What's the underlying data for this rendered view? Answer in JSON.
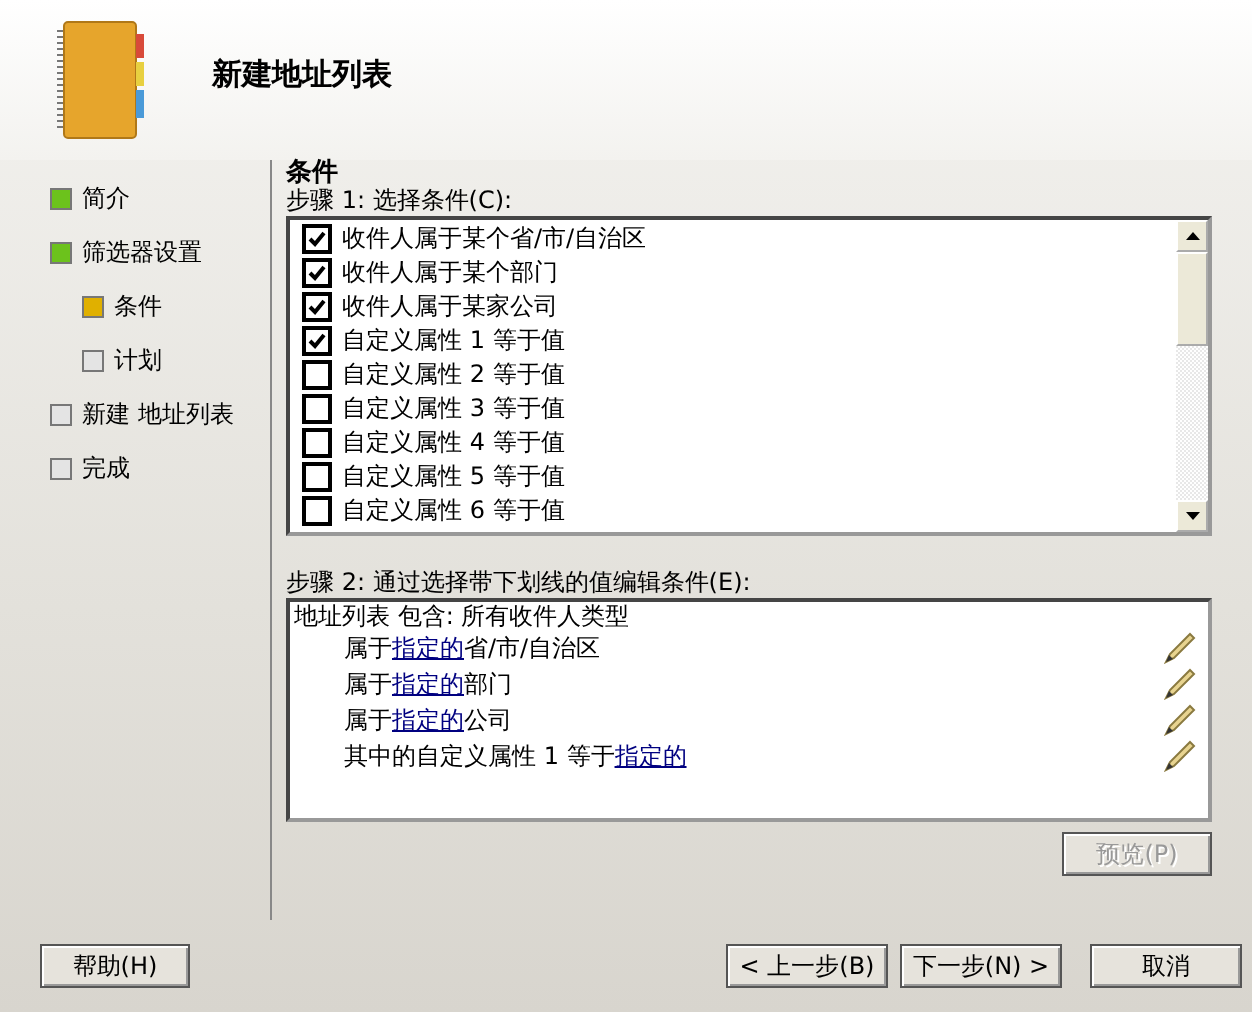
{
  "wizard": {
    "title": "新建地址列表"
  },
  "nav": [
    {
      "label": "简介",
      "completed": true,
      "selected": false
    },
    {
      "label": "筛选器设置",
      "completed": true,
      "selected": false,
      "children": [
        {
          "label": "条件",
          "completed": false,
          "selected": true
        },
        {
          "label": "计划",
          "completed": false,
          "selected": false
        }
      ]
    },
    {
      "label": "新建 地址列表",
      "completed": false,
      "selected": false
    },
    {
      "label": "完成",
      "completed": false,
      "selected": false
    }
  ],
  "page": {
    "heading": "条件",
    "step1_label": "步骤 1: 选择条件(C):",
    "conditions": [
      {
        "label": "收件人属于某个省/市/自治区",
        "checked": true
      },
      {
        "label": "收件人属于某个部门",
        "checked": true
      },
      {
        "label": "收件人属于某家公司",
        "checked": true
      },
      {
        "label": "自定义属性 1 等于值",
        "checked": true
      },
      {
        "label": "自定义属性 2 等于值",
        "checked": false
      },
      {
        "label": "自定义属性 3 等于值",
        "checked": false
      },
      {
        "label": "自定义属性 4 等于值",
        "checked": false
      },
      {
        "label": "自定义属性 5 等于值",
        "checked": false
      },
      {
        "label": "自定义属性 6 等于值",
        "checked": false
      }
    ],
    "step2_label": "步骤 2: 通过选择带下划线的值编辑条件(E):",
    "summary": {
      "header": "地址列表 包含: 所有收件人类型",
      "lines": [
        {
          "parts": [
            {
              "text": "属于"
            },
            {
              "text": "指定的",
              "link": true
            },
            {
              "text": "省/市/自治区"
            }
          ]
        },
        {
          "parts": [
            {
              "text": "属于"
            },
            {
              "text": "指定的",
              "link": true
            },
            {
              "text": "部门"
            }
          ]
        },
        {
          "parts": [
            {
              "text": "属于"
            },
            {
              "text": "指定的",
              "link": true
            },
            {
              "text": "公司"
            }
          ]
        },
        {
          "parts": [
            {
              "text": "其中的自定义属性 1 等于"
            },
            {
              "text": "指定的",
              "link": true
            }
          ]
        }
      ]
    },
    "preview_button": {
      "label": "预览(P)",
      "disabled": true
    }
  },
  "buttons": {
    "help": "帮助(H)",
    "back": "< 上一步(B)",
    "next": "下一步(N) >",
    "cancel": "取消"
  }
}
